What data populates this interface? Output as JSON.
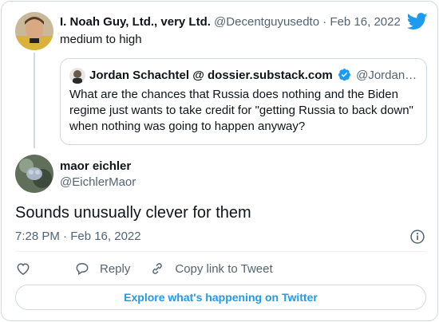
{
  "parent_tweet": {
    "author_name": "I. Noah Guy, Ltd., very Ltd.",
    "handle": "@Decentguyusedto",
    "separator": "·",
    "date": "Feb 16, 2022",
    "text": "medium to high"
  },
  "quoted_tweet": {
    "author_name": "Jordan Schachtel @ dossier.substack.com",
    "handle": "@Jordan…",
    "text": "What are the chances that Russia does nothing and the Biden regime just wants to take credit for \"getting Russia to back down\" when nothing was going to happen anyway?"
  },
  "main_tweet": {
    "author_name": "maor eichler",
    "handle": "@EichlerMaor",
    "text": "Sounds unusually clever for them",
    "timestamp": "7:28 PM · Feb 16, 2022"
  },
  "actions": {
    "reply_label": "Reply",
    "copy_label": "Copy link to Tweet"
  },
  "explore_label": "Explore what's happening on Twitter",
  "icons": {
    "brand": "twitter-bird-icon",
    "verified": "verified-badge-icon",
    "info": "info-icon",
    "like": "heart-icon",
    "reply": "reply-bubble-icon",
    "copy": "link-icon"
  },
  "colors": {
    "accent": "#1d9bf0",
    "secondary_text": "#536471",
    "border": "#cfd9de"
  }
}
